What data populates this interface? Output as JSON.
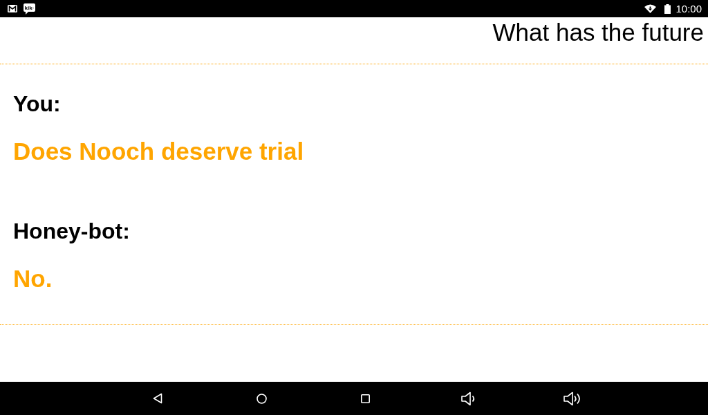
{
  "status_bar": {
    "notification_badge": "kik·",
    "time": "10:00"
  },
  "title": "What has the future",
  "conversation": [
    {
      "speaker": "You:",
      "message": "Does Nooch deserve trial"
    },
    {
      "speaker": "Honey-bot:",
      "message": "No."
    }
  ]
}
